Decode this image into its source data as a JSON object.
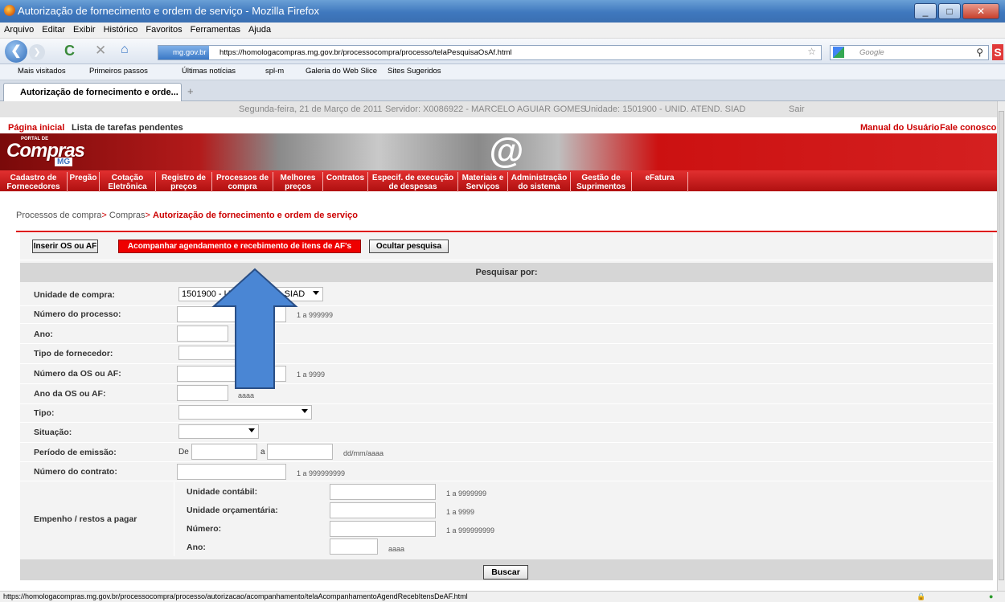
{
  "window": {
    "title": "Autorização de fornecimento e ordem de serviço - Mozilla Firefox"
  },
  "menubar": [
    "Arquivo",
    "Editar",
    "Exibir",
    "Histórico",
    "Favoritos",
    "Ferramentas",
    "Ajuda"
  ],
  "nav": {
    "site_badge": "mg.gov.br",
    "url": "https://homologacompras.mg.gov.br/processocompra/processo/telaPesquisaOsAf.html",
    "search_placeholder": "Google"
  },
  "bookmarks": [
    "Mais visitados",
    "Primeiros passos",
    "Últimas notícias",
    "spl-m",
    "Galeria do Web Slice",
    "Sites Sugeridos"
  ],
  "tab": {
    "label": "Autorização de fornecimento e orde...",
    "new_tab": "+"
  },
  "infobar": {
    "date": "Segunda-feira, 21 de Março de 2011",
    "server": "Servidor: X0086922 - MARCELO AGUIAR GOMES",
    "unit": "Unidade: 1501900 - UNID. ATEND. SIAD",
    "logout": "Sair"
  },
  "toplinks": {
    "home": "Página inicial",
    "tasks": "Lista de tarefas pendentes",
    "manual": "Manual do Usuário",
    "contact": "Fale conosco"
  },
  "logo": {
    "top": "PORTAL DE",
    "main": "Compras",
    "sub": "MG"
  },
  "mainmenu": [
    [
      "Cadastro de",
      "Fornecedores"
    ],
    [
      "Pregão",
      ""
    ],
    [
      "Cotação",
      "Eletrônica"
    ],
    [
      "Registro de",
      "preços"
    ],
    [
      "Processos de",
      "compra"
    ],
    [
      "Melhores",
      "preços"
    ],
    [
      "Contratos",
      ""
    ],
    [
      "Especif. de execução",
      "de despesas"
    ],
    [
      "Materiais e",
      "Serviços"
    ],
    [
      "Administração",
      "do sistema"
    ],
    [
      "Gestão de",
      "Suprimentos"
    ],
    [
      "eFatura",
      ""
    ]
  ],
  "breadcrumb": {
    "part1": "Processos de compra",
    "sep": ">",
    "part2": "Compras",
    "current": "Autorização de fornecimento e ordem de serviço"
  },
  "buttons": {
    "insert": "Inserir OS ou AF",
    "track": "Acompanhar agendamento e recebimento de itens de AF's",
    "hide": "Ocultar pesquisa"
  },
  "form": {
    "heading": "Pesquisar por:",
    "unidade_compra": {
      "label": "Unidade de compra:",
      "value": "1501900 - UNID. ATEND. SIAD"
    },
    "numero_processo": {
      "label": "Número do processo:",
      "hint": "1 a 999999"
    },
    "ano": {
      "label": "Ano:"
    },
    "tipo_fornecedor": {
      "label": "Tipo de fornecedor:"
    },
    "numero_os": {
      "label": "Número da OS ou AF:",
      "hint": "1 a 9999"
    },
    "ano_os": {
      "label": "Ano da OS ou AF:",
      "hint": "aaaa"
    },
    "tipo": {
      "label": "Tipo:"
    },
    "situacao": {
      "label": "Situação:"
    },
    "periodo": {
      "label": "Período de emissão:",
      "de": "De",
      "a": "a",
      "hint": "dd/mm/aaaa"
    },
    "contrato": {
      "label": "Número do contrato:",
      "hint": "1 a 999999999"
    },
    "empenho": {
      "label": "Empenho / restos a pagar",
      "unidade_contabil": {
        "label": "Unidade contábil:",
        "hint": "1 a 9999999"
      },
      "unidade_orcamentaria": {
        "label": "Unidade orçamentária:",
        "hint": "1 a 9999"
      },
      "numero": {
        "label": "Número:",
        "hint": "1 a 999999999"
      },
      "ano": {
        "label": "Ano:",
        "hint": "aaaa"
      }
    },
    "search_button": "Buscar"
  },
  "status": "https://homologacompras.mg.gov.br/processocompra/processo/autorizacao/acompanhamento/telaAcompanhamentoAgendRecebItensDeAF.html",
  "colors": {
    "brand_red": "#c00000",
    "arrow_blue": "#4a86d4",
    "title_blue": "#3f78be"
  }
}
